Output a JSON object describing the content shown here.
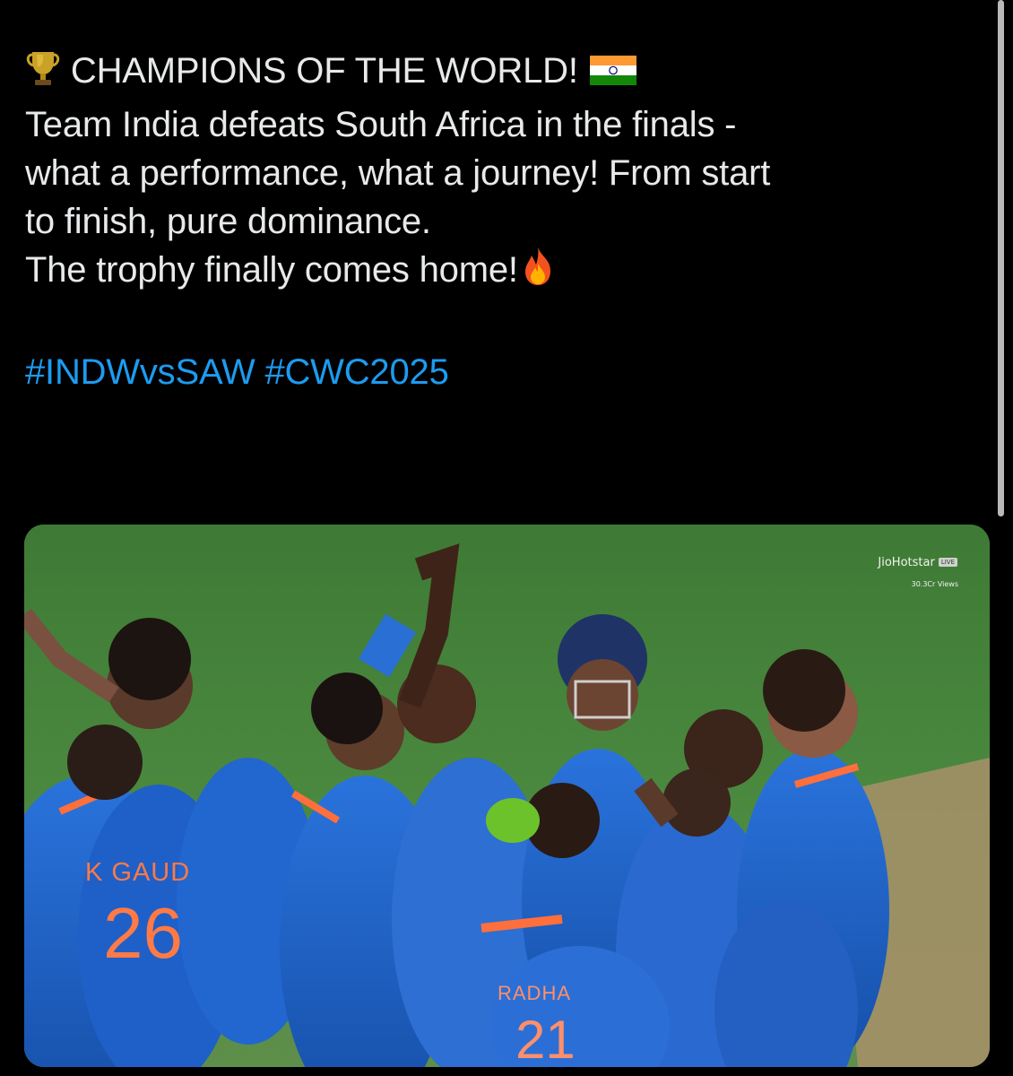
{
  "post": {
    "lines": [
      "CHAMPIONS OF THE WORLD!",
      "Team India defeats South Africa in the finals -",
      "what a performance, what a journey! From start",
      "to finish, pure dominance.",
      "The trophy finally comes home!"
    ],
    "emoji": {
      "trophy": "trophy-icon",
      "flag": "india-flag-icon",
      "fire": "fire-icon"
    },
    "hashtags": [
      "#INDWvsSAW",
      "#CWC2025"
    ]
  },
  "media": {
    "broadcaster": "JioHotstar",
    "live_badge": "LIVE",
    "views": "30.3Cr Views",
    "jersey_name_1": "K GAUD",
    "jersey_number_1": "26",
    "jersey_name_2": "RADHA",
    "jersey_number_2": "21"
  },
  "colors": {
    "background": "#000000",
    "text": "#e7e9ea",
    "hashtag": "#1d9bf0",
    "jersey_blue": "#1f5fc8"
  }
}
